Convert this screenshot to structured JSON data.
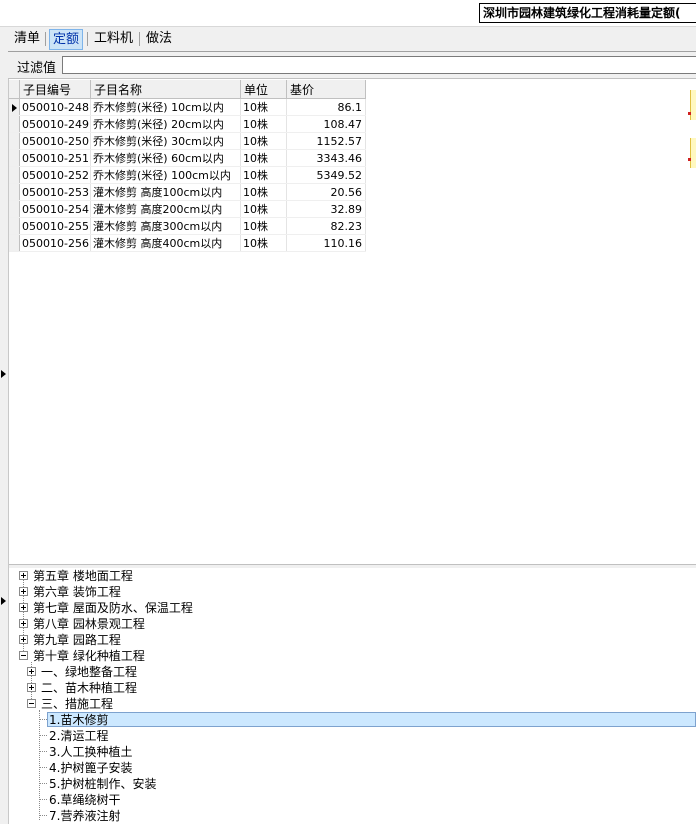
{
  "window": {
    "title": "深圳市园林建筑绿化工程消耗量定额("
  },
  "tabs": [
    {
      "label": "清单"
    },
    {
      "label": "定额"
    },
    {
      "label": "工料机"
    },
    {
      "label": "做法"
    }
  ],
  "filter": {
    "label": "过滤值",
    "value": ""
  },
  "grid": {
    "columns": [
      "子目编号",
      "子目名称",
      "单位",
      "基价"
    ],
    "rows": [
      {
        "code": "050010-248",
        "name": "乔木修剪(米径) 10cm以内",
        "unit": "10株",
        "price": "86.1"
      },
      {
        "code": "050010-249",
        "name": "乔木修剪(米径) 20cm以内",
        "unit": "10株",
        "price": "108.47"
      },
      {
        "code": "050010-250",
        "name": "乔木修剪(米径) 30cm以内",
        "unit": "10株",
        "price": "1152.57"
      },
      {
        "code": "050010-251",
        "name": "乔木修剪(米径) 60cm以内",
        "unit": "10株",
        "price": "3343.46"
      },
      {
        "code": "050010-252",
        "name": "乔木修剪(米径) 100cm以内",
        "unit": "10株",
        "price": "5349.52"
      },
      {
        "code": "050010-253",
        "name": "灌木修剪 高度100cm以内",
        "unit": "10株",
        "price": "20.56"
      },
      {
        "code": "050010-254",
        "name": "灌木修剪 高度200cm以内",
        "unit": "10株",
        "price": "32.89"
      },
      {
        "code": "050010-255",
        "name": "灌木修剪 高度300cm以内",
        "unit": "10株",
        "price": "82.23"
      },
      {
        "code": "050010-256",
        "name": "灌木修剪 高度400cm以内",
        "unit": "10株",
        "price": "110.16"
      }
    ]
  },
  "tree": [
    {
      "label": "第五章  楼地面工程",
      "expander": "plus"
    },
    {
      "label": "第六章  装饰工程",
      "expander": "plus"
    },
    {
      "label": "第七章  屋面及防水、保温工程",
      "expander": "plus"
    },
    {
      "label": "第八章  园林景观工程",
      "expander": "plus"
    },
    {
      "label": "第九章  园路工程",
      "expander": "plus"
    },
    {
      "label": "第十章  绿化种植工程",
      "expander": "minus"
    },
    {
      "label": "一、绿地整备工程",
      "expander": "plus"
    },
    {
      "label": "二、苗木种植工程",
      "expander": "plus"
    },
    {
      "label": "三、措施工程",
      "expander": "minus"
    },
    {
      "label": "1.苗木修剪",
      "selected": true
    },
    {
      "label": "2.清运工程"
    },
    {
      "label": "3.人工换种植土"
    },
    {
      "label": "4.护树篦子安装"
    },
    {
      "label": "5.护树桩制作、安装"
    },
    {
      "label": "6.草绳绕树干"
    },
    {
      "label": "7.营养液注射"
    }
  ]
}
